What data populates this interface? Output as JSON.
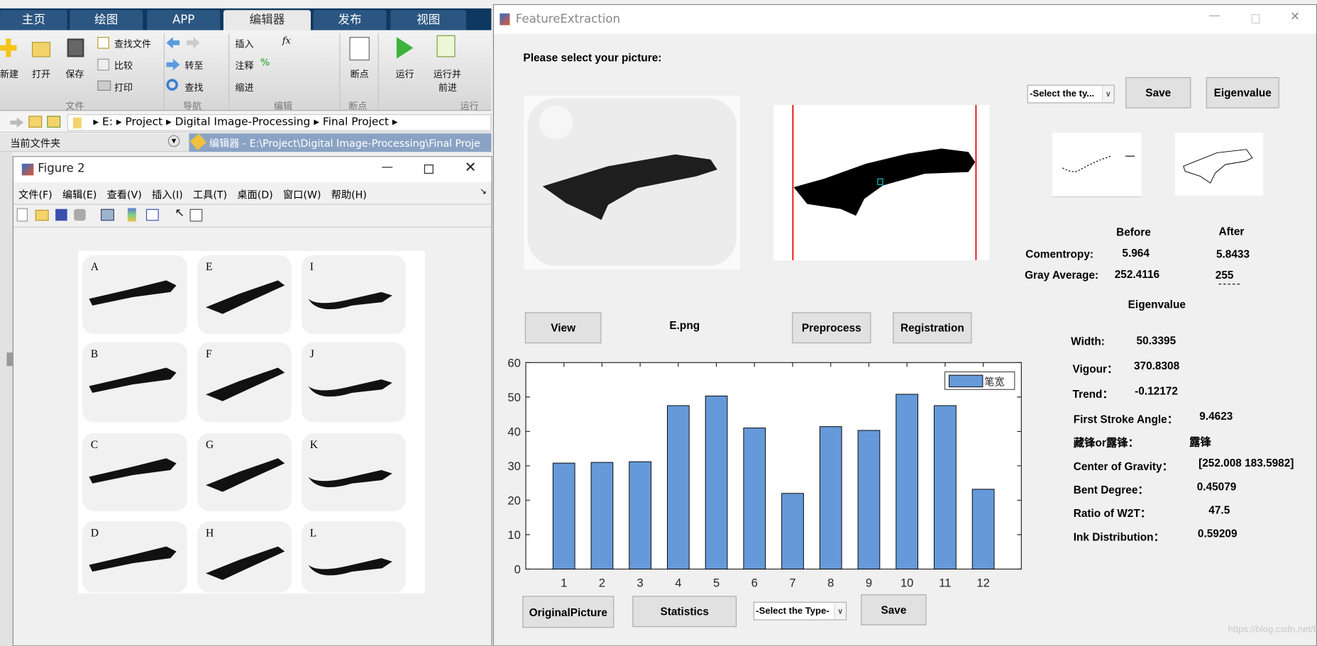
{
  "matlab": {
    "tabs": [
      "主页",
      "绘图",
      "APP",
      "编辑器",
      "发布",
      "视图"
    ],
    "ribbon": {
      "new": "新建",
      "open": "打开",
      "save": "保存",
      "find_files": "查找文件",
      "compare": "比较",
      "print": "打印",
      "go_to": "转至",
      "find": "查找",
      "insert": "插入",
      "comment": "注释",
      "indent": "缩进",
      "breakpoints": "断点",
      "run": "运行",
      "run_advance_1": "运行并",
      "run_advance_2": "前进",
      "groups": [
        "文件",
        "导航",
        "编辑",
        "断点",
        "运行"
      ]
    },
    "address_path": [
      "E:",
      "Project",
      "Digital Image-Processing",
      "Final Project"
    ],
    "current_folder": "当前文件夹",
    "editor_tab": "编辑器 - E:\\Project\\Digital Image-Processing\\Final Proje"
  },
  "figure2": {
    "title": "Figure 2",
    "menus": [
      "文件(F)",
      "编辑(E)",
      "查看(V)",
      "插入(I)",
      "工具(T)",
      "桌面(D)",
      "窗口(W)",
      "帮助(H)"
    ],
    "panel_labels": [
      "A",
      "E",
      "I",
      "B",
      "F",
      "J",
      "C",
      "G",
      "K",
      "D",
      "H",
      "L"
    ]
  },
  "feature": {
    "title": "FeatureExtraction",
    "prompt": "Please select your picture:",
    "select_top": "-Select the ty...",
    "save_top": "Save",
    "eigen_button": "Eigenvalue",
    "before": "Before",
    "after": "After",
    "comentropy_label": "Comentropy:",
    "comentropy_before": "5.964",
    "comentropy_after": "5.8433",
    "gray_label": "Gray Average:",
    "gray_before": "252.4116",
    "gray_after": "255",
    "eigen_title": "Eigenvalue",
    "features": [
      {
        "label": "Width:",
        "value": "50.3395"
      },
      {
        "label": "Vigour：",
        "value": "370.8308"
      },
      {
        "label": "Trend：",
        "value": "-0.12172"
      },
      {
        "label": "First Stroke Angle：",
        "value": "9.4623"
      },
      {
        "label": "藏锋or露锋：",
        "value": "露锋"
      },
      {
        "label": "Center of Gravity：",
        "value": "[252.008 183.5982]"
      },
      {
        "label": "Bent Degree：",
        "value": "0.45079"
      },
      {
        "label": "Ratio of W2T：",
        "value": "47.5"
      },
      {
        "label": "Ink Distribution：",
        "value": "0.59209"
      }
    ],
    "view": "View",
    "filename": "E.png",
    "preprocess": "Preprocess",
    "registration": "Registration",
    "original_picture": "OriginalPicture",
    "statistics": "Statistics",
    "select_bottom": "-Select the Type-",
    "save_bottom": "Save",
    "watermark": "https://blog.csdn.net/FShirley"
  },
  "chart_data": {
    "type": "bar",
    "categories": [
      "1",
      "2",
      "3",
      "4",
      "5",
      "6",
      "7",
      "8",
      "9",
      "10",
      "11",
      "12"
    ],
    "series": [
      {
        "name": "笔宽",
        "values": [
          30.8,
          31.0,
          31.2,
          47.5,
          50.3,
          41.0,
          22.0,
          41.4,
          40.3,
          50.8,
          47.5,
          23.2
        ],
        "color": "#6699d9"
      }
    ],
    "ylim": [
      0,
      60
    ],
    "yticks": [
      0,
      10,
      20,
      30,
      40,
      50,
      60
    ],
    "legend": "top-right",
    "grid": false
  }
}
